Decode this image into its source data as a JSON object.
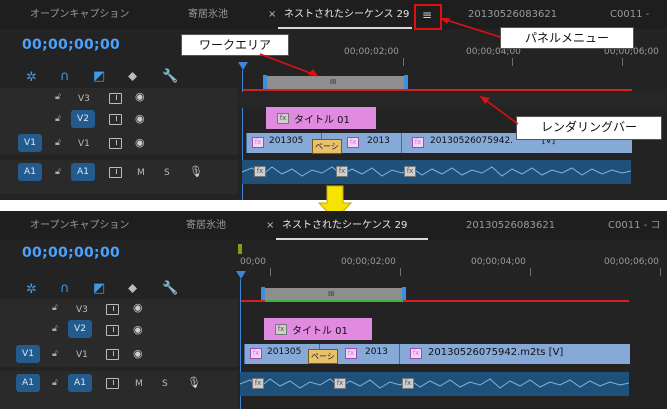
{
  "tabs": {
    "source_monitor": "オープンキャプション",
    "program_monitor": "寄居氷池",
    "sequence_close": "×",
    "sequence_tab": "ネストされたシーケンス 29",
    "clip_tab": "20130526083621",
    "c0011_tab": "C0011 -",
    "c0011_tab_bottom": "C0011 - コ"
  },
  "panel_menu_glyph": "≡",
  "timecode": "00;00;00;00",
  "ruler": {
    "t1": "00;00",
    "t2": "00;00;02;00",
    "t3": "00;00;04;00",
    "t4": "00;00;06;00",
    "t4_top": "00;00;06;00"
  },
  "tracks": {
    "v3": "V3",
    "v2": "V2",
    "v1_src": "V1",
    "v1": "V1",
    "a1_src": "A1",
    "a1": "A1",
    "m": "M",
    "s": "S"
  },
  "clips": {
    "title": "タイトル 01",
    "clip_a": "201305",
    "transition": "ペーシ",
    "clip_b": "2013",
    "clip_c_top": "20130526075942.",
    "clip_c_top_tail": "[V]",
    "clip_c_bottom": "20130526075942.m2ts [V]",
    "fx": "fx",
    "bar_handle": "III"
  },
  "callouts": {
    "work_area": "ワークエリア",
    "panel_menu": "パネルメニュー",
    "render_bar": "レンダリングバー"
  },
  "colors": {
    "accent_blue": "#4aa2ff",
    "render_red": "#d62020",
    "render_green": "#3cb43c",
    "title_clip": "#e08ae0",
    "video_clip": "#86a9d8",
    "arrow_yellow": "#f5e400"
  }
}
